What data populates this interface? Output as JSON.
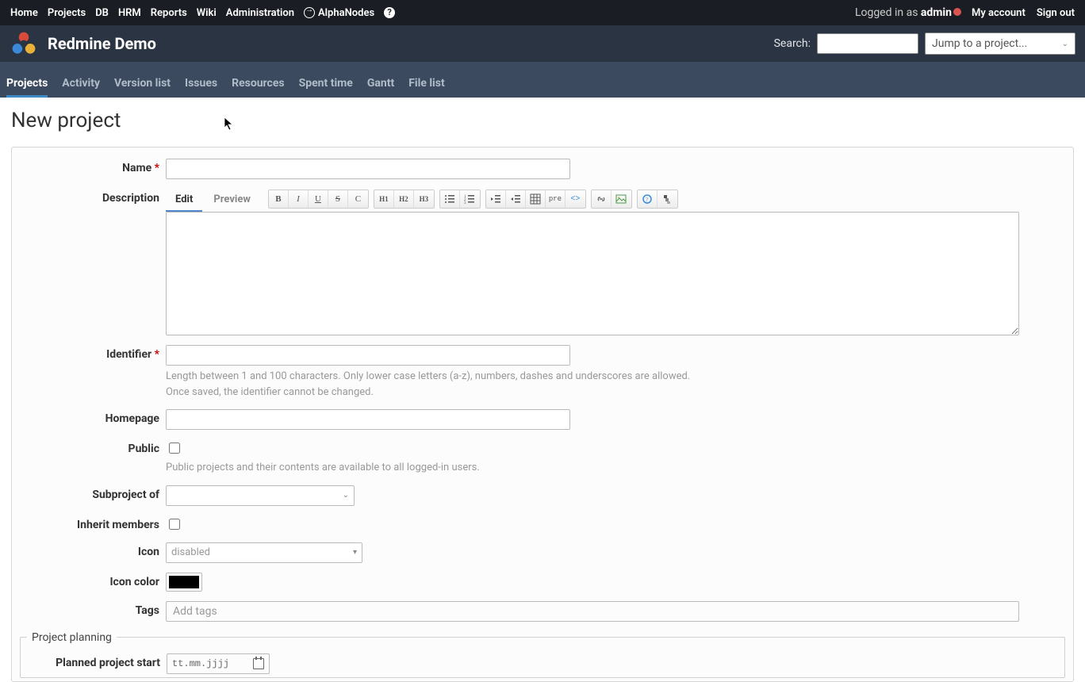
{
  "topmenu": {
    "home": "Home",
    "projects": "Projects",
    "db": "DB",
    "hrm": "HRM",
    "reports": "Reports",
    "wiki": "Wiki",
    "admin": "Administration",
    "alphanodes": "AlphaNodes"
  },
  "account": {
    "logged_in_as": "Logged in as ",
    "username": "admin",
    "my_account": "My account",
    "sign_out": "Sign out"
  },
  "header": {
    "title": "Redmine Demo",
    "search_label": "Search:",
    "project_jump": "Jump to a project..."
  },
  "mainmenu": {
    "projects": "Projects",
    "activity": "Activity",
    "version_list": "Version list",
    "issues": "Issues",
    "resources": "Resources",
    "spent_time": "Spent time",
    "gantt": "Gantt",
    "file_list": "File list"
  },
  "page": {
    "title": "New project"
  },
  "form": {
    "name_label": "Name",
    "description_label": "Description",
    "edit_tab": "Edit",
    "preview_tab": "Preview",
    "identifier_label": "Identifier",
    "identifier_hint1": "Length between 1 and 100 characters. Only lower case letters (a-z), numbers, dashes and underscores are allowed.",
    "identifier_hint2": "Once saved, the identifier cannot be changed.",
    "homepage_label": "Homepage",
    "public_label": "Public",
    "public_hint": "Public projects and their contents are available to all logged-in users.",
    "subproject_label": "Subproject of",
    "inherit_label": "Inherit members",
    "icon_label": "Icon",
    "icon_value": "disabled",
    "icon_color_label": "Icon color",
    "tags_label": "Tags",
    "tags_placeholder": "Add tags",
    "planning_legend": "Project planning",
    "planned_start_label": "Planned project start",
    "date_placeholder": "tt.mm.jjjj"
  },
  "toolbar": {
    "bold": "B",
    "italic": "I",
    "underline": "U",
    "strike": "S",
    "code": "C",
    "h1": "H1",
    "h2": "H2",
    "h3": "H3",
    "pre": "pre"
  }
}
